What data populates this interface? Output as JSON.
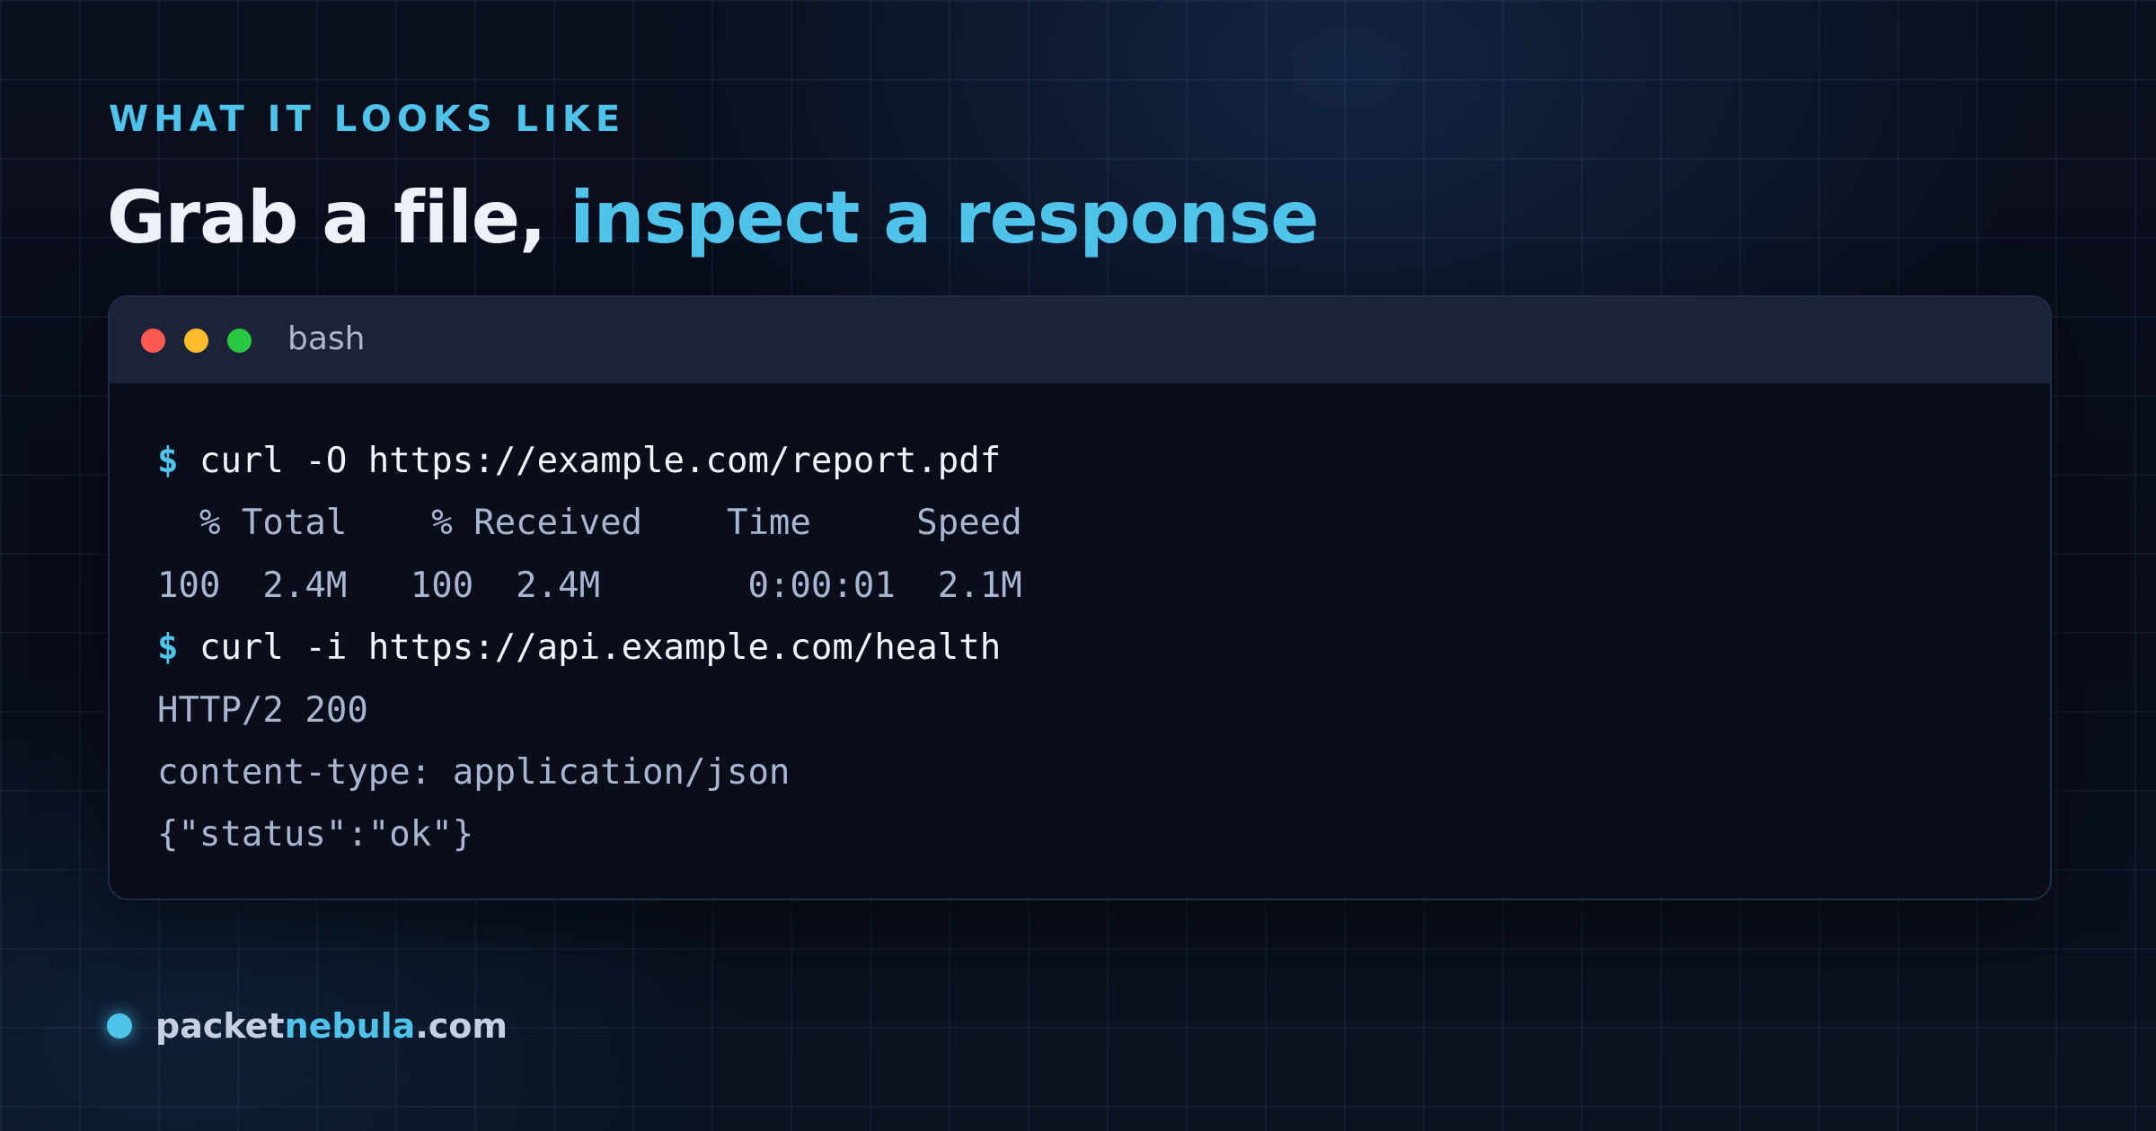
{
  "eyebrow": "WHAT IT LOOKS LIKE",
  "headline": {
    "lead": "Grab a file,",
    "accent": "inspect a response"
  },
  "terminal": {
    "title": "bash",
    "prompt_symbol": "$",
    "lines": [
      {
        "type": "command",
        "text": "curl -O https://example.com/report.pdf"
      },
      {
        "type": "output",
        "text": "  % Total    % Received    Time     Speed"
      },
      {
        "type": "output",
        "text": "100  2.4M   100  2.4M       0:00:01  2.1M"
      },
      {
        "type": "command",
        "text": "curl -i https://api.example.com/health"
      },
      {
        "type": "output",
        "text": "HTTP/2 200"
      },
      {
        "type": "output",
        "text": "content-type: application/json"
      },
      {
        "type": "output",
        "text": "{\"status\":\"ok\"}"
      }
    ]
  },
  "footer": {
    "brand_prefix": "packet",
    "brand_accent": "nebula",
    "brand_suffix": ".com"
  },
  "colors": {
    "accent": "#4fc3ea",
    "background": "#090d1a",
    "terminal_bg": "#0a0e1a",
    "titlebar_bg": "#1c2238",
    "window_red": "#ff5a52",
    "window_yellow": "#fdbb2e",
    "window_green": "#28c840"
  }
}
